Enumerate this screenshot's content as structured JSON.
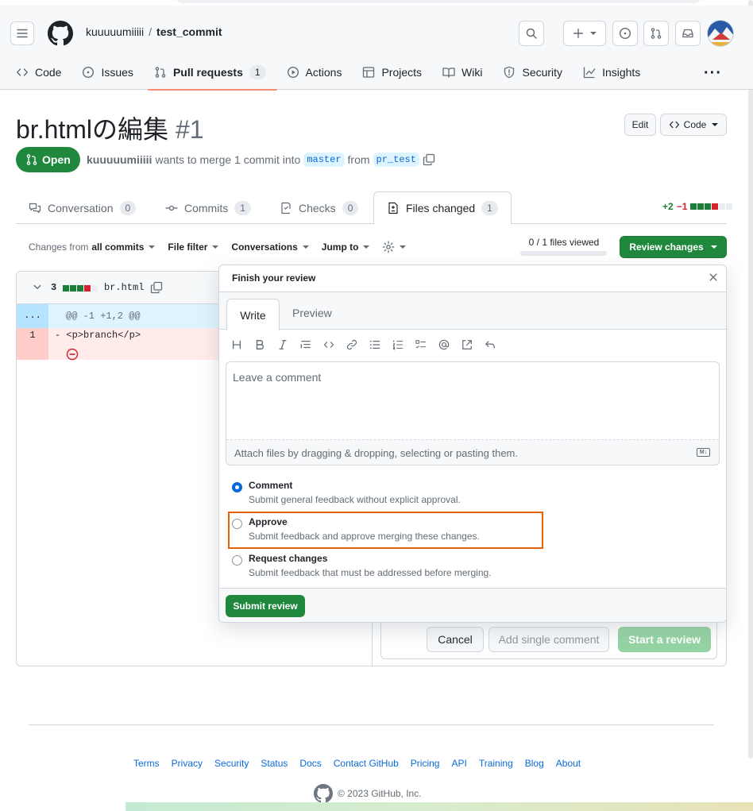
{
  "header": {
    "owner": "kuuuuumiiiii",
    "separator": "/",
    "repo": "test_commit",
    "nav": [
      {
        "label": "Code",
        "icon": "code-icon"
      },
      {
        "label": "Issues",
        "icon": "issue-opened-icon"
      },
      {
        "label": "Pull requests",
        "icon": "git-pull-request-icon",
        "count": "1"
      },
      {
        "label": "Actions",
        "icon": "play-icon"
      },
      {
        "label": "Projects",
        "icon": "table-icon"
      },
      {
        "label": "Wiki",
        "icon": "book-icon"
      },
      {
        "label": "Security",
        "icon": "shield-icon"
      },
      {
        "label": "Insights",
        "icon": "graph-icon"
      }
    ],
    "more": "···"
  },
  "pr": {
    "title": "br.htmlの編集",
    "number": "#1",
    "edit_label": "Edit",
    "code_label": "Code",
    "state": "Open",
    "author": "kuuuuumiiiii",
    "merge_text": "wants to merge 1 commit into",
    "base_branch": "master",
    "from_text": "from",
    "head_branch": "pr_test"
  },
  "tabs": {
    "conversation": {
      "label": "Conversation",
      "count": "0"
    },
    "commits": {
      "label": "Commits",
      "count": "1"
    },
    "checks": {
      "label": "Checks",
      "count": "0"
    },
    "files": {
      "label": "Files changed",
      "count": "1"
    },
    "additions": "+2",
    "deletions": "−1"
  },
  "toolbar": {
    "changes_prefix": "Changes from",
    "changes_value": "all commits",
    "file_filter": "File filter",
    "conversations": "Conversations",
    "jump_to": "Jump to",
    "viewed": "0 / 1 files viewed",
    "review_changes": "Review changes"
  },
  "file": {
    "count": "3",
    "name": "br.html",
    "hunk_marker": "...",
    "hunk_header": "@@ -1 +1,2 @@",
    "line_number": "1",
    "line_sign": "-",
    "line_code": "<p>branch</p>"
  },
  "inline_actions": {
    "cancel": "Cancel",
    "add_single": "Add single comment",
    "start_review": "Start a review"
  },
  "review": {
    "title": "Finish your review",
    "write_tab": "Write",
    "preview_tab": "Preview",
    "placeholder": "Leave a comment",
    "attach_text": "Attach files by dragging & dropping, selecting or pasting them.",
    "md_badge": "M↓",
    "options": [
      {
        "label": "Comment",
        "desc": "Submit general feedback without explicit approval.",
        "checked": true
      },
      {
        "label": "Approve",
        "desc": "Submit feedback and approve merging these changes.",
        "checked": false
      },
      {
        "label": "Request changes",
        "desc": "Submit feedback that must be addressed before merging.",
        "checked": false
      }
    ],
    "submit": "Submit review"
  },
  "footer": {
    "links": [
      "Terms",
      "Privacy",
      "Security",
      "Status",
      "Docs",
      "Contact GitHub",
      "Pricing",
      "API",
      "Training",
      "Blog",
      "About"
    ],
    "copyright": "© 2023 GitHub, Inc."
  },
  "colors": {
    "accent_green": "#1f883d",
    "link_blue": "#0969da",
    "tab_underline": "#fd8c73",
    "highlight_orange": "#e36209"
  }
}
